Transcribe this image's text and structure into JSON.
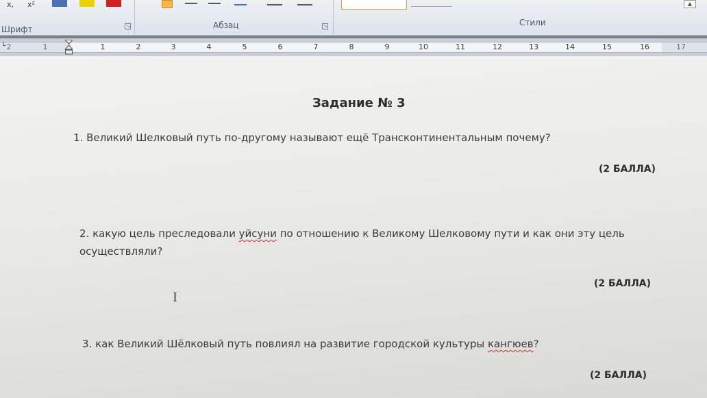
{
  "ribbon": {
    "groups": [
      {
        "label": "Шрифт"
      },
      {
        "label": "Абзац"
      },
      {
        "label": "Стили"
      }
    ],
    "tools": {
      "subscript": "x,",
      "superscript": "x²"
    }
  },
  "ruler": {
    "numbers_left": [
      "2",
      "1"
    ],
    "numbers": [
      "1",
      "2",
      "3",
      "4",
      "5",
      "6",
      "7",
      "8",
      "9",
      "10",
      "11",
      "12",
      "13",
      "14",
      "15",
      "16"
    ],
    "number_right": "17"
  },
  "document": {
    "title": "Задание № 3",
    "questions": [
      {
        "text": "1. Великий Шелковый путь по-другому называют ещё Трансконтинентальным почему?",
        "score": "(2 БАЛЛА)"
      },
      {
        "line1_before": "2. какую цель преследовали ",
        "line1_misspelled": "уйсуни",
        "line1_after": " по отношению к Великому Шелковому пути и как они эту цель",
        "line2": "осуществляли?",
        "score": "(2 БАЛЛА)"
      },
      {
        "text_before": "3. как Великий Шёлковый путь повлиял на развитие городской культуры  ",
        "text_misspelled": "кангюев",
        "text_after": "?",
        "score": "(2 БАЛЛА)"
      }
    ]
  }
}
